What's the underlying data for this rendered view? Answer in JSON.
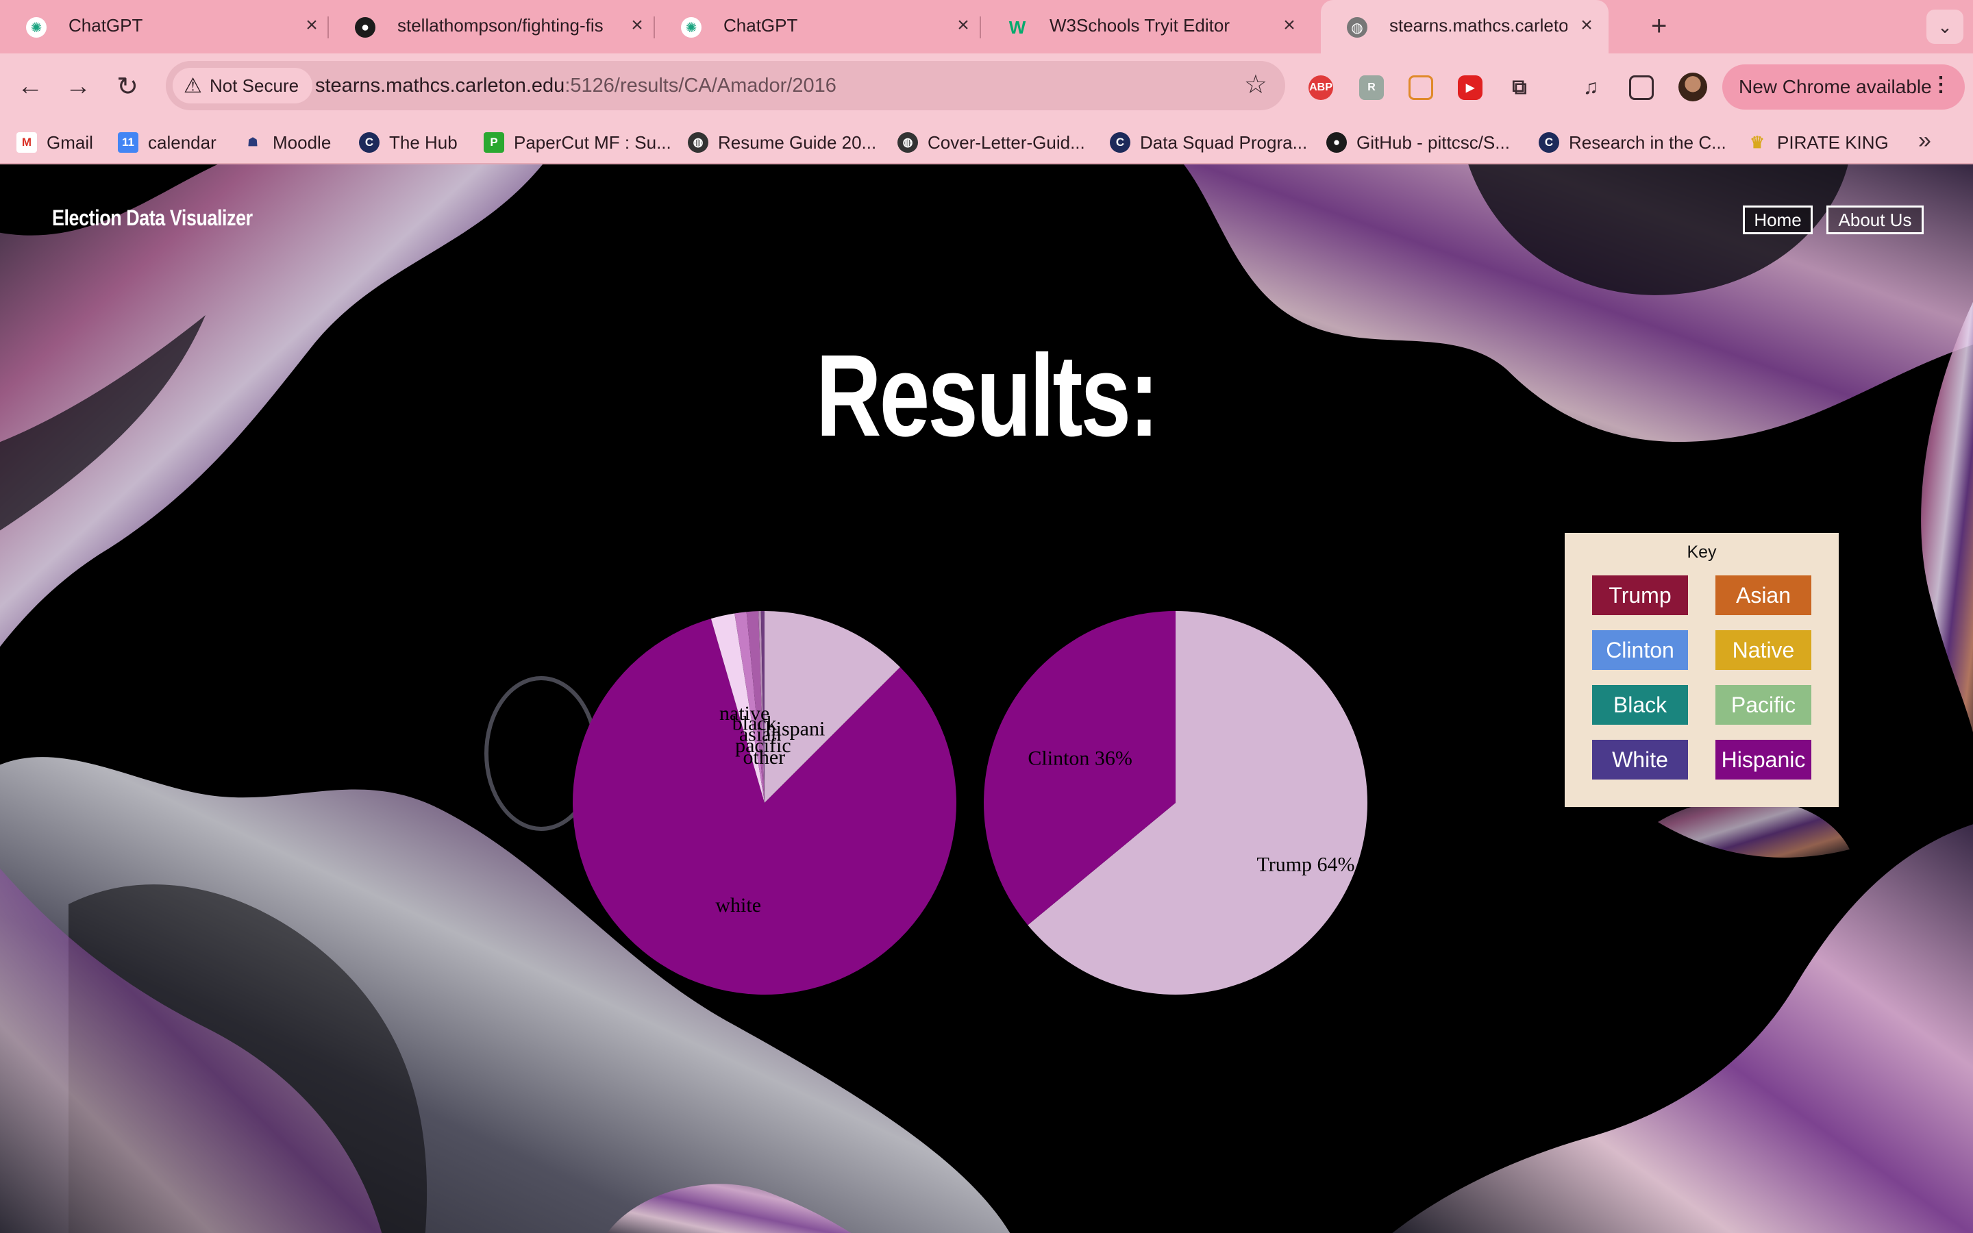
{
  "browser": {
    "tabs": [
      {
        "title": "ChatGPT",
        "icon": "chatgpt-icon"
      },
      {
        "title": "stellathompson/fighting-fish",
        "icon": "github-icon"
      },
      {
        "title": "ChatGPT",
        "icon": "chatgpt-icon"
      },
      {
        "title": "W3Schools Tryit Editor",
        "icon": "w3schools-icon"
      },
      {
        "title": "stearns.mathcs.carleton.edu:",
        "icon": "globe-icon"
      }
    ],
    "security_label": "Not Secure",
    "url_host": "stearns.mathcs.carleton.edu",
    "url_rest": ":5126/results/CA/Amador/2016",
    "update_label": "New Chrome available",
    "bookmarks": [
      {
        "label": "Gmail",
        "icon": "gmail-icon"
      },
      {
        "label": "calendar",
        "icon": "calendar-icon"
      },
      {
        "label": "Moodle",
        "icon": "moodle-icon"
      },
      {
        "label": "The Hub",
        "icon": "hub-icon"
      },
      {
        "label": "PaperCut MF : Su...",
        "icon": "papercut-icon"
      },
      {
        "label": "Resume Guide 20...",
        "icon": "globe-icon"
      },
      {
        "label": "Cover-Letter-Guid...",
        "icon": "globe-icon"
      },
      {
        "label": "Data Squad Progra...",
        "icon": "hub-icon"
      },
      {
        "label": "GitHub - pittcsc/S...",
        "icon": "github-icon"
      },
      {
        "label": "Research in the C...",
        "icon": "hub-icon"
      },
      {
        "label": "PIRATE KING",
        "icon": "crown-icon"
      }
    ]
  },
  "site": {
    "title": "Election Data Visualizer",
    "nav": {
      "home": "Home",
      "about": "About Us"
    },
    "heading": "Results:"
  },
  "key": {
    "title": "Key",
    "items": [
      {
        "label": "Trump",
        "color": "#8b1538"
      },
      {
        "label": "Asian",
        "color": "#c96622"
      },
      {
        "label": "Clinton",
        "color": "#5b8ee0"
      },
      {
        "label": "Native",
        "color": "#d9a81e"
      },
      {
        "label": "Black",
        "color": "#1a857e"
      },
      {
        "label": "Pacific",
        "color": "#8fbf86"
      },
      {
        "label": "White",
        "color": "#4b3a8c"
      },
      {
        "label": "Hispanic",
        "color": "#800883"
      }
    ]
  },
  "chart_data": [
    {
      "type": "pie",
      "labels": [
        "hispanic",
        "white",
        "native",
        "black",
        "asian",
        "pacific",
        "other"
      ],
      "values": [
        12.5,
        83.0,
        2.0,
        1.0,
        1.0,
        0.2,
        0.3
      ],
      "colors": [
        "#d4b6d4",
        "#860884",
        "#f1d3f1",
        "#c57cc5",
        "#a85ca8",
        "#b890b8",
        "#6e3c7e"
      ],
      "slice_labels": [
        "hispani",
        "white",
        "native",
        "black",
        "asian",
        "pacific",
        "other"
      ]
    },
    {
      "type": "pie",
      "labels": [
        "Trump",
        "Clinton"
      ],
      "values": [
        64,
        36
      ],
      "colors": [
        "#d4b6d4",
        "#860884"
      ],
      "slice_labels": [
        "Trump 64%",
        "Clinton 36%"
      ]
    }
  ]
}
